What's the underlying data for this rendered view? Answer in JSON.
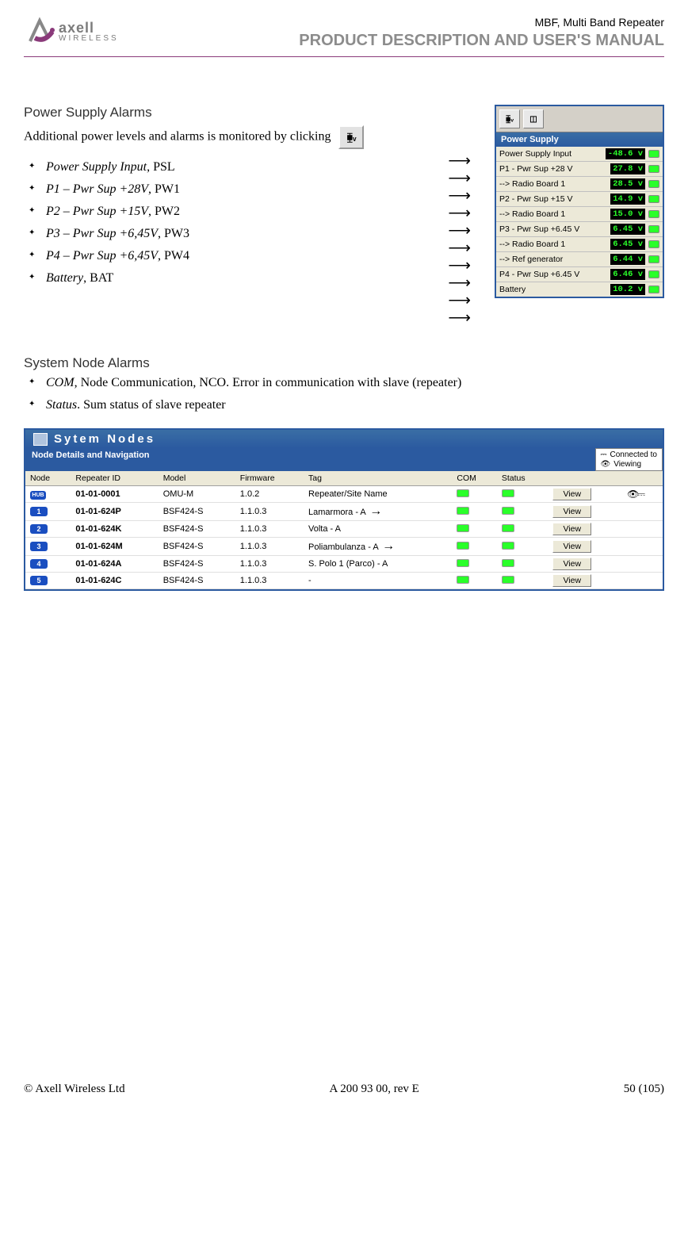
{
  "header": {
    "logo_name": "axell",
    "logo_sub": "WIRELESS",
    "doc_title": "MBF, Multi Band Repeater",
    "doc_subtitle": "PRODUCT DESCRIPTION AND USER'S MANUAL"
  },
  "powerSupply": {
    "heading": "Power Supply Alarms",
    "intro": "Additional power levels and alarms is monitored by clicking",
    "bullets": [
      {
        "italic": "Power Supply Input",
        "rest": ", PSL"
      },
      {
        "italic": "P1 – Pwr Sup +28V",
        "rest": ", PW1"
      },
      {
        "italic": "P2 – Pwr Sup +15V",
        "rest": ", PW2"
      },
      {
        "italic": "P3 – Pwr Sup +6,45V",
        "rest": ", PW3"
      },
      {
        "italic": "P4 – Pwr Sup +6,45V",
        "rest": ", PW4"
      },
      {
        "italic": "Battery",
        "rest": ", BAT"
      }
    ],
    "panel": {
      "title": "Power Supply",
      "rows": [
        {
          "label": "Power Supply Input",
          "value": "-48.6 v"
        },
        {
          "label": "P1 - Pwr Sup +28 V",
          "value": "27.8 v"
        },
        {
          "label": "--> Radio Board 1",
          "value": "28.5 v"
        },
        {
          "label": "P2 - Pwr Sup +15 V",
          "value": "14.9 v"
        },
        {
          "label": "--> Radio Board 1",
          "value": "15.0 v"
        },
        {
          "label": "P3 - Pwr Sup +6.45 V",
          "value": "6.45 v"
        },
        {
          "label": "--> Radio Board 1",
          "value": "6.45 v"
        },
        {
          "label": "--> Ref generator",
          "value": "6.44 v"
        },
        {
          "label": "P4 - Pwr Sup +6.45 V",
          "value": "6.46 v"
        },
        {
          "label": "Battery",
          "value": "10.2 v"
        }
      ]
    }
  },
  "systemNode": {
    "heading": "System Node Alarms",
    "bullets": [
      {
        "italic": "COM",
        "rest": ", Node Communication, NCO.  Error in communication with slave (repeater)"
      },
      {
        "italic": "Status",
        "rest": ". Sum status of slave repeater"
      }
    ],
    "panel": {
      "title": "Sytem  Nodes",
      "subbar": "Node Details and Navigation",
      "legend": {
        "connected": "Connected to",
        "viewing": "Viewing"
      },
      "headers": [
        "Node",
        "Repeater ID",
        "Model",
        "Firmware",
        "Tag",
        "COM",
        "Status",
        "",
        ""
      ],
      "rows": [
        {
          "badge": "HUB",
          "id": "01-01-0001",
          "model": "OMU-M",
          "fw": "1.0.2",
          "tag": "Repeater/Site Name",
          "view": "View",
          "eyes": true,
          "arrow": ""
        },
        {
          "badge": "1",
          "id": "01-01-624P",
          "model": "BSF424-S",
          "fw": "1.1.0.3",
          "tag": "Lamarmora - A",
          "view": "View",
          "eyes": false,
          "arrow": "→"
        },
        {
          "badge": "2",
          "id": "01-01-624K",
          "model": "BSF424-S",
          "fw": "1.1.0.3",
          "tag": "Volta - A",
          "view": "View",
          "eyes": false,
          "arrow": ""
        },
        {
          "badge": "3",
          "id": "01-01-624M",
          "model": "BSF424-S",
          "fw": "1.1.0.3",
          "tag": "Poliambulanza - A",
          "view": "View",
          "eyes": false,
          "arrow": "→"
        },
        {
          "badge": "4",
          "id": "01-01-624A",
          "model": "BSF424-S",
          "fw": "1.1.0.3",
          "tag": "S. Polo 1 (Parco) - A",
          "view": "View",
          "eyes": false,
          "arrow": ""
        },
        {
          "badge": "5",
          "id": "01-01-624C",
          "model": "BSF424-S",
          "fw": "1.1.0.3",
          "tag": "-",
          "view": "View",
          "eyes": false,
          "arrow": ""
        }
      ]
    }
  },
  "footer": {
    "left": "© Axell Wireless Ltd",
    "center": "A 200 93 00, rev E",
    "right": "50 (105)"
  }
}
